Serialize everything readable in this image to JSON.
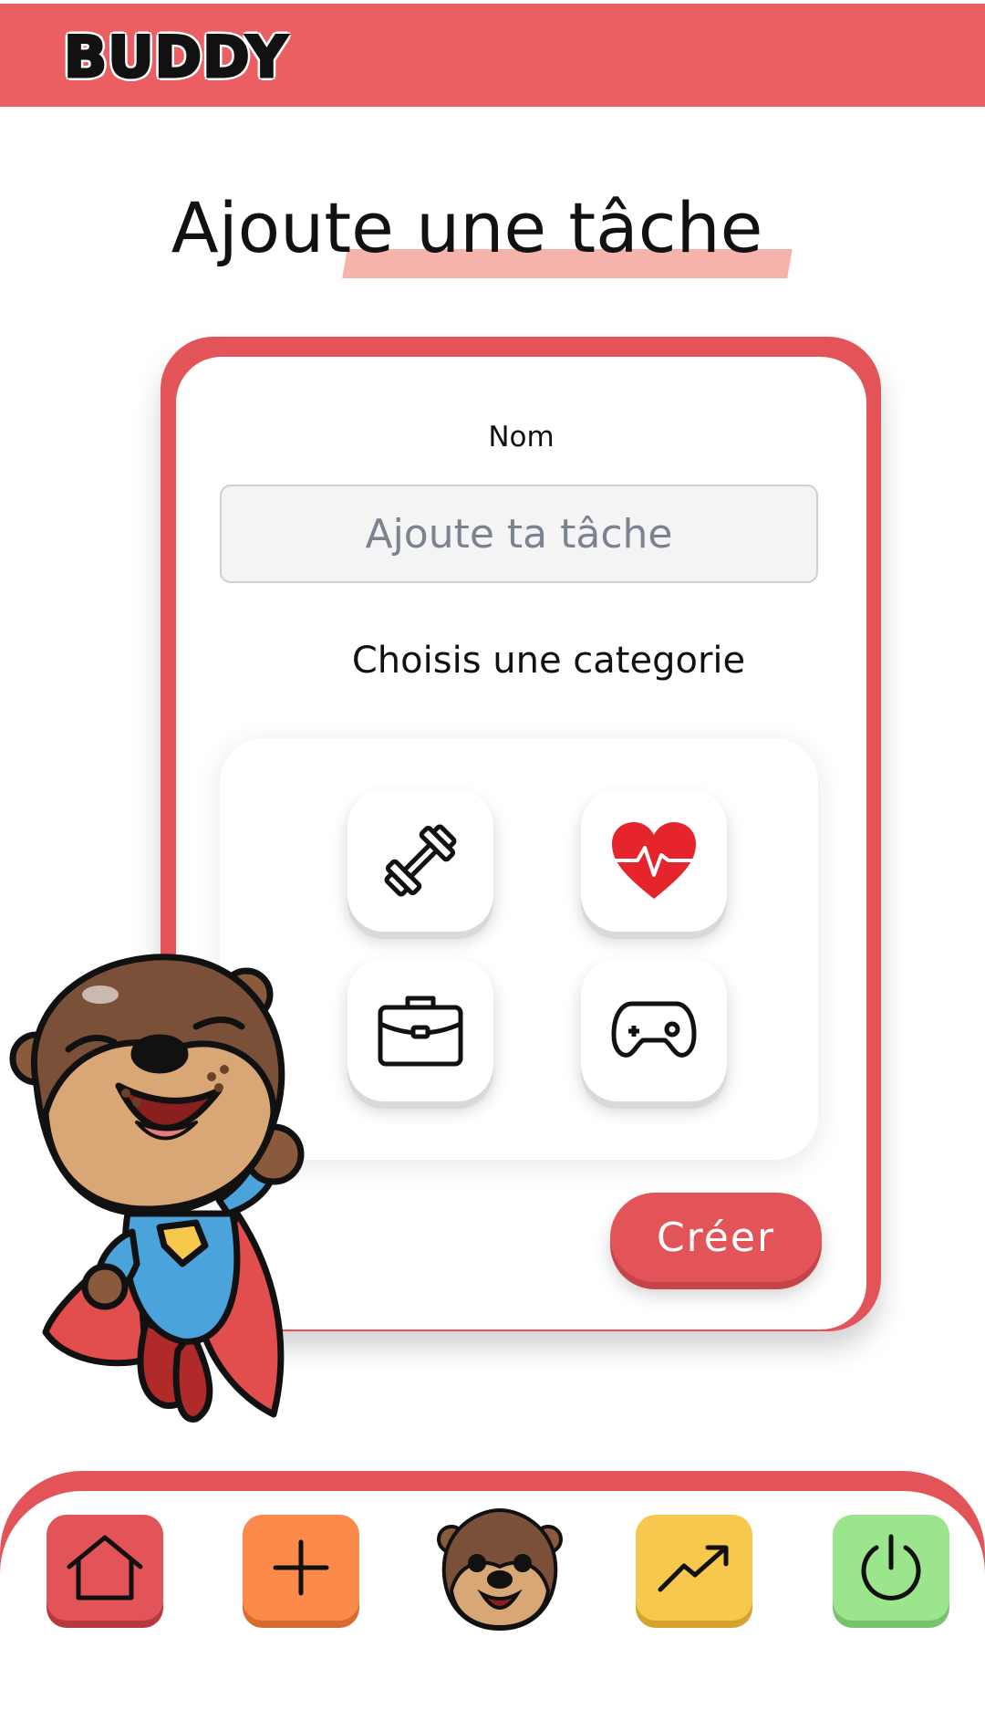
{
  "header": {
    "logo_text": "BUDDY"
  },
  "page": {
    "title": "Ajoute une tâche"
  },
  "form": {
    "name_label": "Nom",
    "name_placeholder": "Ajoute ta tâche",
    "name_value": "",
    "category_label": "Choisis une categorie",
    "categories": [
      {
        "icon": "dumbbell-icon"
      },
      {
        "icon": "heart-pulse-icon"
      },
      {
        "icon": "briefcase-icon"
      },
      {
        "icon": "gamepad-icon"
      }
    ],
    "submit_label": "Créer"
  },
  "bottom_nav": {
    "items": [
      {
        "icon": "home-icon",
        "color": "#e35458"
      },
      {
        "icon": "plus-icon",
        "color": "#fb8a4b"
      },
      {
        "icon": "otter-avatar-icon"
      },
      {
        "icon": "trending-up-icon",
        "color": "#f6c84e"
      },
      {
        "icon": "power-icon",
        "color": "#9be58d"
      }
    ]
  },
  "colors": {
    "brand_red": "#e35458",
    "header_red": "#eb5e62",
    "title_highlight": "#f6b3ab"
  }
}
